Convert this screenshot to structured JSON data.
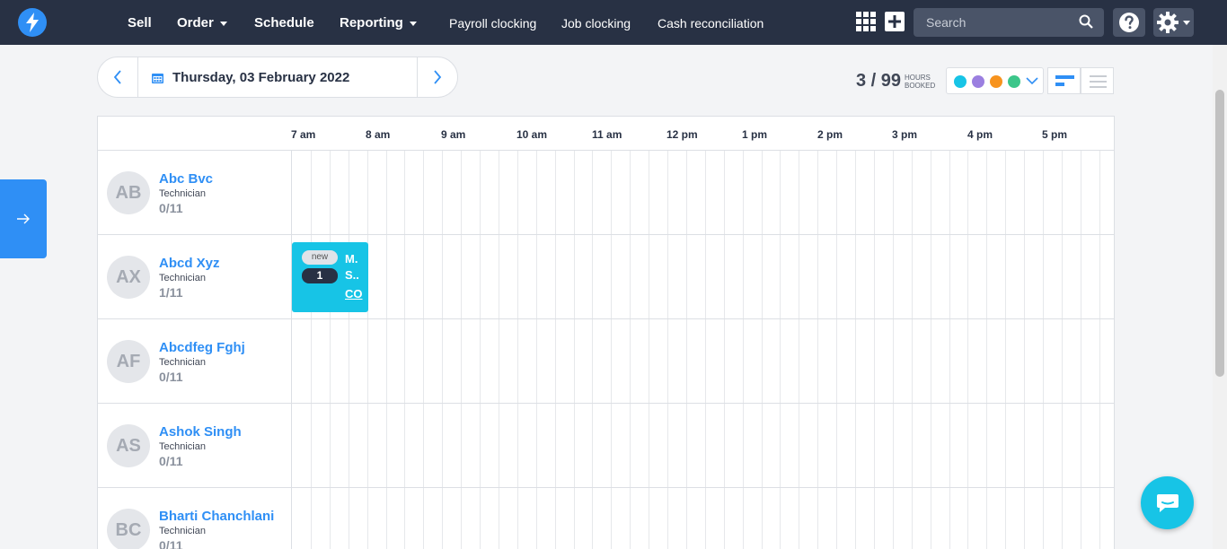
{
  "nav": {
    "sell": "Sell",
    "order": "Order",
    "schedule": "Schedule",
    "reporting": "Reporting",
    "payroll_clocking": "Payroll clocking",
    "job_clocking": "Job clocking",
    "cash_reconciliation": "Cash reconciliation",
    "search_placeholder": "Search"
  },
  "datebar": {
    "date": "Thursday, 03 February 2022"
  },
  "booking": {
    "hours": "3 / 99",
    "label_line1": "HOURS",
    "label_line2": "BOOKED"
  },
  "status_colors": [
    "#17c4e6",
    "#9b7fe0",
    "#f7931e",
    "#3cc68a"
  ],
  "time_labels": [
    "7 am",
    "8 am",
    "9 am",
    "10 am",
    "11 am",
    "12 pm",
    "1 pm",
    "2 pm",
    "3 pm",
    "4 pm",
    "5 pm"
  ],
  "technicians": [
    {
      "initials": "AB",
      "name": "Abc Bvc",
      "role": "Technician",
      "hours": "0/11"
    },
    {
      "initials": "AX",
      "name": "Abcd Xyz",
      "role": "Technician",
      "hours": "1/11"
    },
    {
      "initials": "AF",
      "name": "Abcdfeg Fghj",
      "role": "Technician",
      "hours": "0/11"
    },
    {
      "initials": "AS",
      "name": "Ashok Singh",
      "role": "Technician",
      "hours": "0/11"
    },
    {
      "initials": "BC",
      "name": "Bharti Chanchlani",
      "role": "Technician",
      "hours": "0/11"
    }
  ],
  "job": {
    "status": "new",
    "number": "1",
    "line1": "M.",
    "line2": "S..",
    "link": "CO"
  },
  "colors": {
    "nav_bg": "#283144",
    "accent": "#2f8ff5",
    "job_bg": "#17c4e6"
  }
}
